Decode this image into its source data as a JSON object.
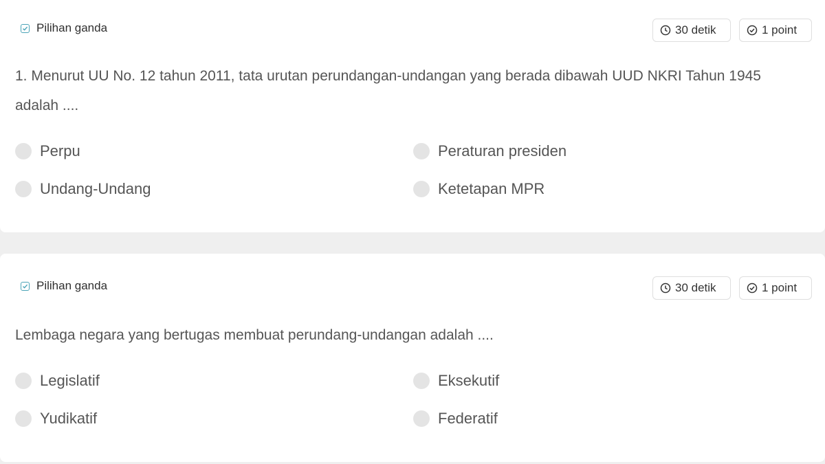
{
  "questions": [
    {
      "type_label": "Pilihan ganda",
      "time_label": "30 detik",
      "point_label": "1 point",
      "text": "1. Menurut UU No. 12 tahun 2011, tata urutan perundangan-undangan yang berada dibawah UUD NKRI Tahun 1945 adalah ....",
      "options": [
        "Perpu",
        "Peraturan presiden",
        "Undang-Undang",
        "Ketetapan MPR"
      ]
    },
    {
      "type_label": "Pilihan ganda",
      "time_label": "30 detik",
      "point_label": "1 point",
      "text": "Lembaga negara yang bertugas membuat perundang-undangan adalah ....",
      "options": [
        "Legislatif",
        "Eksekutif",
        "Yudikatif",
        "Federatif"
      ]
    }
  ],
  "colors": {
    "accent": "#4aa3b7",
    "radio_fill": "#e4e4e4",
    "background": "#efefef"
  },
  "icons": {
    "type": "checkbox-icon",
    "time": "clock-icon",
    "point": "check-circle-icon"
  }
}
